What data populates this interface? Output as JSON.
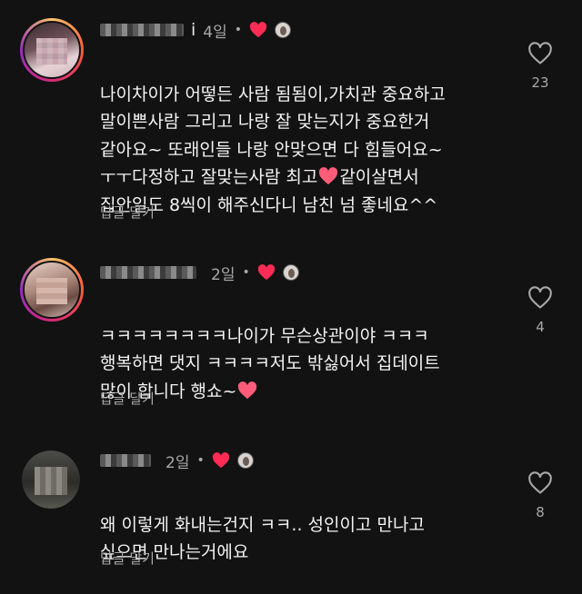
{
  "comments": [
    {
      "user_suffix": "i",
      "time": "4일",
      "dot": "•",
      "text_before_heart": "나이차이가 어떻든 사람 됨됨이,가치관 중요하고\n말이쁜사람 그리고 나랑 잘 맞는지가 중요한거\n같아요~ 또래인들 나랑 안맞으면 다 힘들어요~\nㅜㅜ다정하고 잘맞는사람 최고",
      "text_after_heart": "같이살면서\n집안일도 8씩이 해주신다니 남친 넘 좋네요^^",
      "reply_label": "답글 달기",
      "like_count": "23"
    },
    {
      "user_suffix": "",
      "time": "2일",
      "dot": "•",
      "text_before_heart": "ㅋㅋㅋㅋㅋㅋㅋㅋ나이가 무슨상관이야 ㅋㅋㅋ\n행복하면 댓지 ㅋㅋㅋㅋ저도 밖싫어서 집데이트\n많이 합니다 행쇼~",
      "text_after_heart": "",
      "reply_label": "답글 달기",
      "like_count": "4"
    },
    {
      "user_suffix": "",
      "time": "2일",
      "dot": "•",
      "text_before_heart": "왜 이렇게 화내는건지 ㅋㅋ.. 성인이고 만나고\n싶으면 만나는거에요",
      "text_after_heart": "",
      "reply_label": "답글 달기",
      "like_count": "8"
    }
  ],
  "colors": {
    "background": "#121212",
    "heart": "#fe2c55",
    "secondary_text": "#a8a8a8"
  },
  "icons": [
    "heart-outline-icon",
    "heart-filled-icon",
    "creator-avatar-icon"
  ]
}
